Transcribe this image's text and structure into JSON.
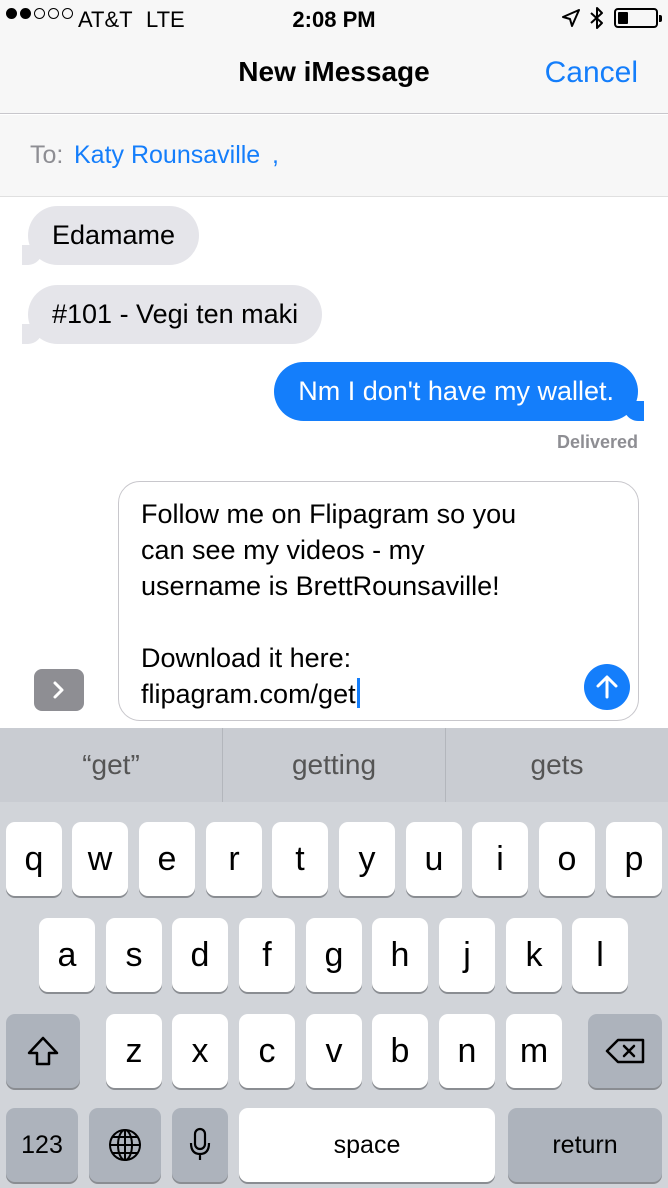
{
  "status_bar": {
    "carrier": "AT&T",
    "network": "LTE",
    "time": "2:08 PM",
    "signal_bars": 2,
    "signal_total": 5,
    "battery_level": 0.25,
    "icons": [
      "location-arrow-icon",
      "bluetooth-icon",
      "battery-icon"
    ]
  },
  "nav": {
    "title": "New iMessage",
    "cancel_label": "Cancel"
  },
  "to_field": {
    "label": "To:",
    "recipient": "Katy Rounsaville",
    "separator": ","
  },
  "messages": [
    {
      "direction": "incoming",
      "text": "Edamame"
    },
    {
      "direction": "incoming",
      "text": "#101 - Vegi ten maki"
    },
    {
      "direction": "outgoing",
      "text": "Nm I don't have my wallet."
    }
  ],
  "delivery_status": "Delivered",
  "compose": {
    "lines": [
      "Follow me on Flipagram so you",
      "can see my videos - my",
      "username is BrettRounsaville!",
      "",
      "Download it here:",
      "flipagram.com/get"
    ]
  },
  "keyboard": {
    "suggestions": [
      "“get”",
      "getting",
      "gets"
    ],
    "row1": [
      "q",
      "w",
      "e",
      "r",
      "t",
      "y",
      "u",
      "i",
      "o",
      "p"
    ],
    "row2": [
      "a",
      "s",
      "d",
      "f",
      "g",
      "h",
      "j",
      "k",
      "l"
    ],
    "row3": [
      "z",
      "x",
      "c",
      "v",
      "b",
      "n",
      "m"
    ],
    "numbers_label": "123",
    "space_label": "space",
    "return_label": "return"
  },
  "colors": {
    "accent": "#147efb",
    "incoming_bubble": "#e5e5ea",
    "keyboard_bg": "#d1d4d9"
  }
}
